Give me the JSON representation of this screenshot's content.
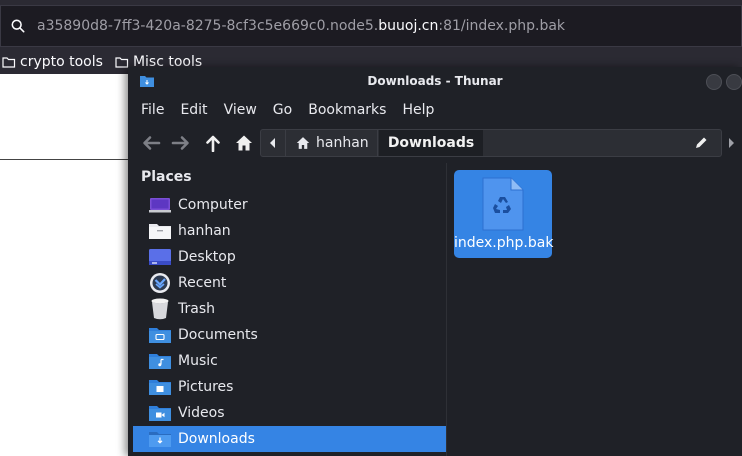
{
  "browser": {
    "url_prefix": "a35890d8-7ff3-420a-8275-8cf3c5e669c0.node5.",
    "url_domain": "buuoj.cn",
    "url_suffix": ":81/index.php.bak",
    "bookmarks": [
      {
        "label": "crypto tools",
        "icon": "folder-icon"
      },
      {
        "label": "Misc tools",
        "icon": "folder-icon"
      }
    ]
  },
  "window": {
    "title": "Downloads - Thunar",
    "menu": [
      "File",
      "Edit",
      "View",
      "Go",
      "Bookmarks",
      "Help"
    ]
  },
  "pathbar": {
    "home_label": "hanhan",
    "current_label": "Downloads"
  },
  "sidebar": {
    "header": "Places",
    "items": [
      {
        "label": "Computer",
        "icon": "computer-icon"
      },
      {
        "label": "hanhan",
        "icon": "home-folder-icon"
      },
      {
        "label": "Desktop",
        "icon": "desktop-icon"
      },
      {
        "label": "Recent",
        "icon": "recent-icon"
      },
      {
        "label": "Trash",
        "icon": "trash-icon"
      },
      {
        "label": "Documents",
        "icon": "documents-folder-icon"
      },
      {
        "label": "Music",
        "icon": "music-folder-icon"
      },
      {
        "label": "Pictures",
        "icon": "pictures-folder-icon"
      },
      {
        "label": "Videos",
        "icon": "videos-folder-icon"
      },
      {
        "label": "Downloads",
        "icon": "downloads-folder-icon",
        "selected": true
      }
    ]
  },
  "files": [
    {
      "name": "index.php.bak",
      "icon": "backup-file-icon",
      "selected": true
    }
  ],
  "colors": {
    "selection": "#3584e4",
    "window_bg": "#1f2127",
    "folder_blue": "#3f8fe0"
  }
}
